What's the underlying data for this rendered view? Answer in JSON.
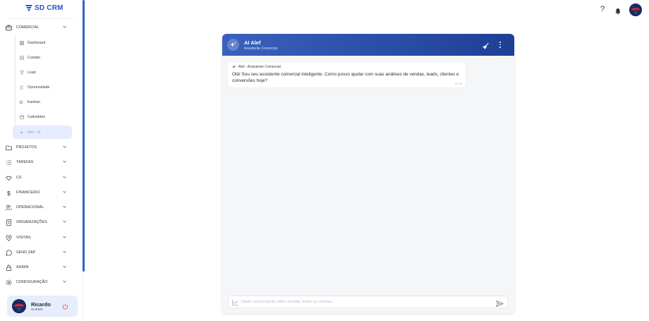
{
  "app": {
    "logo_text": "SD CRM"
  },
  "sidebar": {
    "comercial": {
      "label": "COMERCIAL"
    },
    "sub_items": [
      {
        "label": "Dashboard"
      },
      {
        "label": "Contato"
      },
      {
        "label": "Lead"
      },
      {
        "label": "Oportunidade"
      },
      {
        "label": "Kanban"
      },
      {
        "label": "Calendário"
      },
      {
        "label": "Alef - IA"
      }
    ],
    "sections": [
      {
        "label": "PROJETOS",
        "icon": "folder-icon"
      },
      {
        "label": "TAREFAS",
        "icon": "list-icon"
      },
      {
        "label": "CS",
        "icon": "handshake-icon"
      },
      {
        "label": "FINANCEIRO",
        "icon": "dollar-icon"
      },
      {
        "label": "OPERACIONAL",
        "icon": "users-icon"
      },
      {
        "label": "ORGANIZAÇÕES",
        "icon": "building-icon"
      },
      {
        "label": "VISITAS",
        "icon": "map-pin-icon"
      },
      {
        "label": "SEND ZAP",
        "icon": "whatsapp-icon"
      },
      {
        "label": "ADMIN",
        "icon": "lock-icon"
      },
      {
        "label": "CONFIGURAÇÃO",
        "icon": "gear-icon"
      }
    ]
  },
  "user": {
    "name": "Ricardo",
    "role": "SUPER"
  },
  "topbar": {
    "help": "?"
  },
  "chat": {
    "bot_name": "AI Alef",
    "bot_subtitle": "Assistente Comercial",
    "message": {
      "author": "Alef - Assistente Comercial",
      "text": "Olá! Sou seu assistente comercial inteligente. Como posso ajudar com suas análises de vendas, leads, clientes e conversões hoje?",
      "time": "09:39"
    },
    "input_placeholder": "Digite sua pergunta sobre vendas, leads ou clientes..."
  },
  "colors": {
    "accent": "#2f63c9",
    "header_start": "#3a61bd",
    "header_end": "#1e3f96",
    "active_item": "#e4ecfd"
  }
}
